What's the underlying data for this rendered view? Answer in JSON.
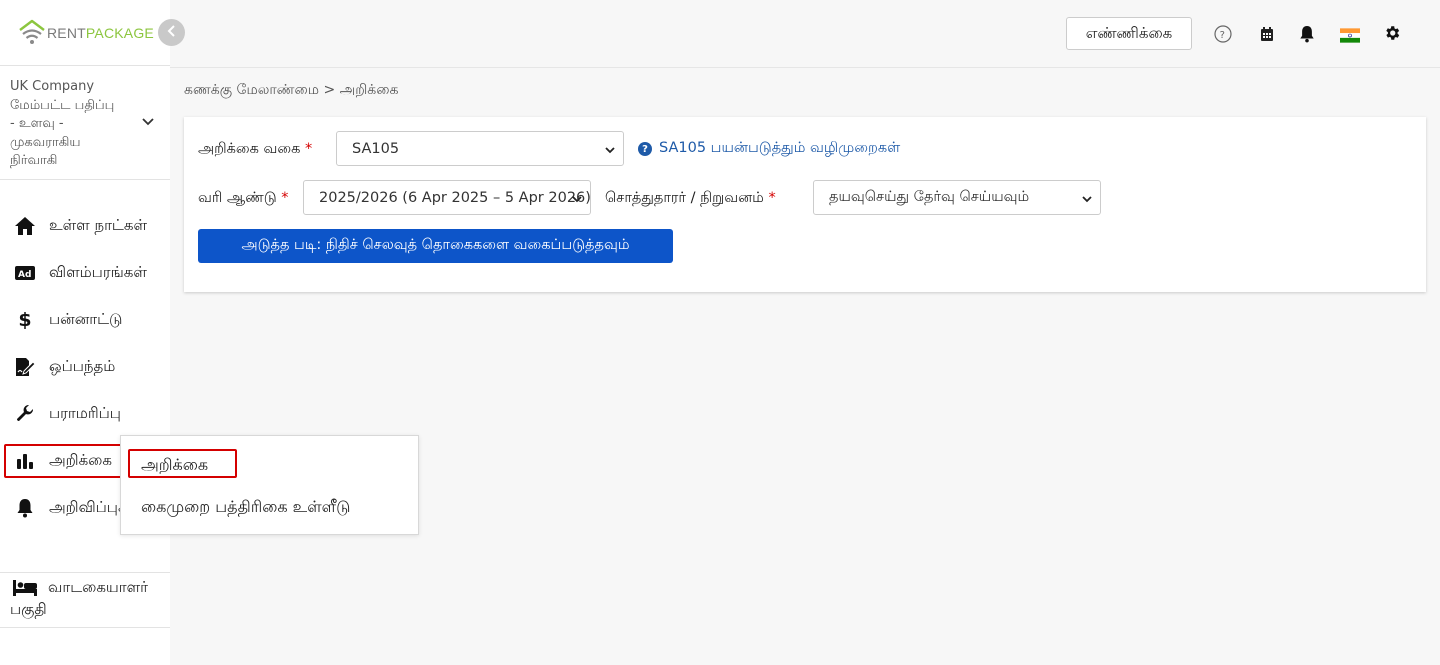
{
  "brand": {
    "logo_rent": "RENT",
    "logo_package": "PACKAGE"
  },
  "company": {
    "name": "UK Company",
    "role": "மேம்பட்ட பதிப்பு - உளவு - முகவராகிய நிர்வாகி"
  },
  "nav": {
    "items": [
      {
        "label": "உள்ள நாட்கள்",
        "icon": "home-icon"
      },
      {
        "label": "விளம்பரங்கள்",
        "icon": "ad-icon"
      },
      {
        "label": "பன்னாட்டு",
        "icon": "dollar-icon"
      },
      {
        "label": "ஒப்பந்தம்",
        "icon": "contract-sign-icon"
      },
      {
        "label": "பராமரிப்பு",
        "icon": "wrench-icon"
      },
      {
        "label": "அறிக்கை",
        "icon": "bar-chart-icon"
      },
      {
        "label": "அறிவிப்புகள்",
        "icon": "bell-icon"
      }
    ],
    "tenant_line1": "வாடகையாளர்",
    "tenant_line2": "பகுதி"
  },
  "header": {
    "count_button": "எண்ணிக்கை",
    "icons": [
      "help-circle-icon",
      "calendar-icon",
      "bell-icon",
      "india-flag-icon",
      "gear-icon"
    ]
  },
  "breadcrumb": "கணக்கு மேலாண்மை > அறிக்கை",
  "form": {
    "report_type_label": "அறிக்கை வகை",
    "report_type_value": "SA105",
    "help_link": "SA105 பயன்படுத்தும் வழிமுறைகள்",
    "tax_year_label": "வரி ஆண்டு",
    "tax_year_value": "2025/2026 (6 Apr 2025 – 5 Apr 2026)",
    "owner_label": "சொத்துதாரர் / நிறுவனம்",
    "owner_value": "தயவுசெய்து தேர்வு செய்யவும்",
    "required_mark": "*",
    "next_button": "அடுத்த படி: நிதிச் செலவுத் தொகைகளை வகைப்படுத்தவும்"
  },
  "popup_menu": {
    "items": [
      "அறிக்கை",
      "கைமுறை பத்திரிகை உள்ளீடு"
    ]
  },
  "colors": {
    "accent": "#0d55c9",
    "brand_green": "#8cc63f",
    "highlight_red": "#d40000",
    "link_blue": "#1e5aa8"
  }
}
